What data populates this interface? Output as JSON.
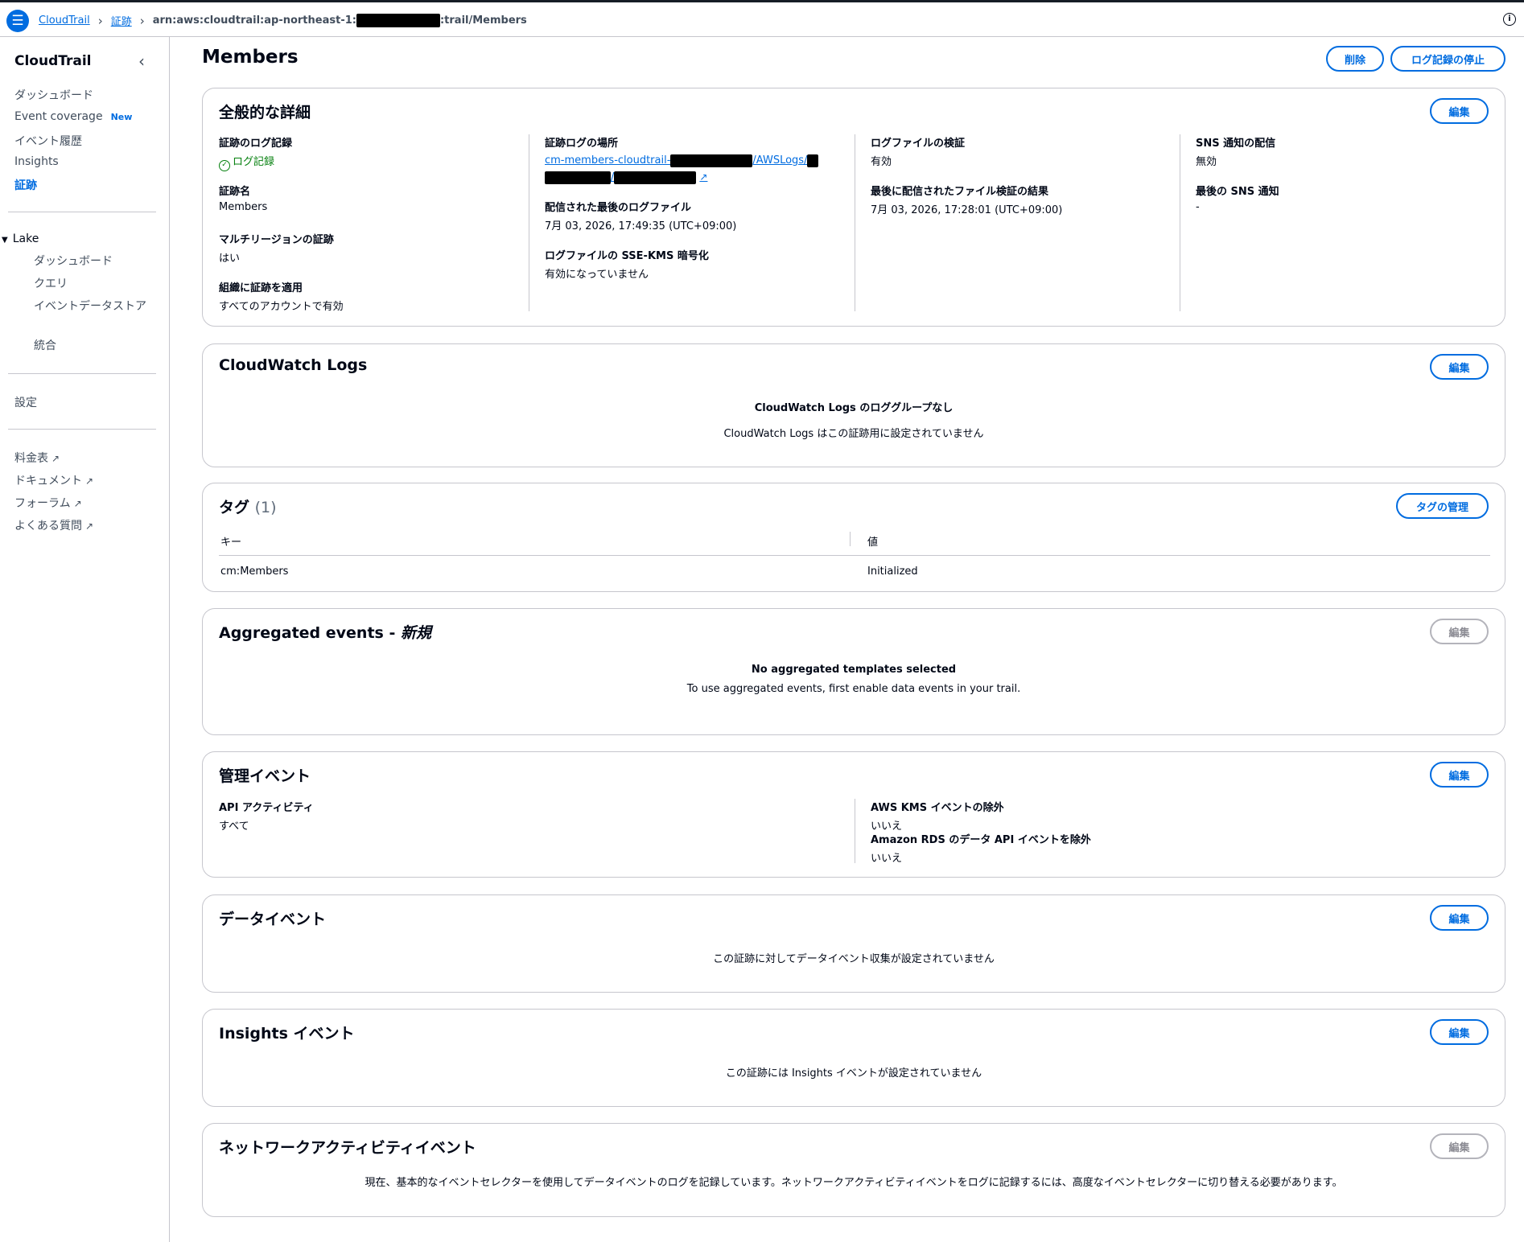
{
  "header": {
    "breadcrumb_root": "CloudTrail",
    "breadcrumb_trails": "証跡",
    "breadcrumb_arn_prefix": "arn:aws:cloudtrail:ap-northeast-1:",
    "breadcrumb_arn_suffix": ":trail/Members"
  },
  "sidebar": {
    "title": "CloudTrail",
    "items": [
      "ダッシュボード",
      "Event coverage",
      "イベント履歴",
      "Insights",
      "証跡"
    ],
    "new_badge": "New",
    "lake_label": "Lake",
    "lake_items": [
      "ダッシュボード",
      "クエリ",
      "イベントデータストア",
      "統合"
    ],
    "settings": "設定",
    "links": [
      "料金表",
      "ドキュメント",
      "フォーラム",
      "よくある質問"
    ]
  },
  "page": {
    "title": "Members",
    "delete_button": "削除",
    "stop_logging_button": "ログ記録の停止"
  },
  "general": {
    "title": "全般的な詳細",
    "edit": "編集",
    "logging_label": "証跡のログ記録",
    "logging_value": "ログ記録",
    "name_label": "証跡名",
    "name_value": "Members",
    "multiregion_label": "マルチリージョンの証跡",
    "multiregion_value": "はい",
    "org_label": "組織に証跡を適用",
    "org_value": "すべてのアカウントで有効",
    "location_label": "証跡ログの場所",
    "location_prefix": "cm-members-cloudtrail-",
    "location_mid": "/AWSLogs/",
    "location_sep": "/",
    "last_log_label": "配信された最後のログファイル",
    "last_log_value": "7月 03, 2026, 17:49:35 (UTC+09:00)",
    "ssekms_label": "ログファイルの SSE-KMS 暗号化",
    "ssekms_value": "有効になっていません",
    "validation_label": "ログファイルの検証",
    "validation_value": "有効",
    "last_validation_label": "最後に配信されたファイル検証の結果",
    "last_validation_value": "7月 03, 2026, 17:28:01 (UTC+09:00)",
    "sns_label": "SNS 通知の配信",
    "sns_value": "無効",
    "last_sns_label": "最後の SNS 通知",
    "last_sns_value": "-"
  },
  "cloudwatch": {
    "title": "CloudWatch Logs",
    "edit": "編集",
    "empty_title": "CloudWatch Logs のロググループなし",
    "empty_desc": "CloudWatch Logs はこの証跡用に設定されていません"
  },
  "tags": {
    "title": "タグ",
    "count": "(1)",
    "manage": "タグの管理",
    "col_key": "キー",
    "col_value": "値",
    "rows": [
      {
        "key": "cm:Members",
        "value": "Initialized"
      }
    ]
  },
  "aggregated": {
    "title": "Aggregated events - ",
    "title_new": "新規",
    "edit": "編集",
    "empty_title": "No aggregated templates selected",
    "empty_desc": "To use aggregated events, first enable data events in your trail."
  },
  "management": {
    "title": "管理イベント",
    "edit": "編集",
    "api_label": "API アクティビティ",
    "api_value": "すべて",
    "kms_label": "AWS KMS イベントの除外",
    "kms_value": "いいえ",
    "rds_label": "Amazon RDS のデータ API イベントを除外",
    "rds_value": "いいえ"
  },
  "data_events": {
    "title": "データイベント",
    "edit": "編集",
    "desc": "この証跡に対してデータイベント収集が設定されていません"
  },
  "insights": {
    "title": "Insights イベント",
    "edit": "編集",
    "desc": "この証跡には Insights イベントが設定されていません"
  },
  "network": {
    "title": "ネットワークアクティビティイベント",
    "edit": "編集",
    "desc": "現在、基本的なイベントセレクターを使用してデータイベントのログを記録しています。ネットワークアクティビティイベントをログに記録するには、高度なイベントセレクターに切り替える必要があります。"
  }
}
